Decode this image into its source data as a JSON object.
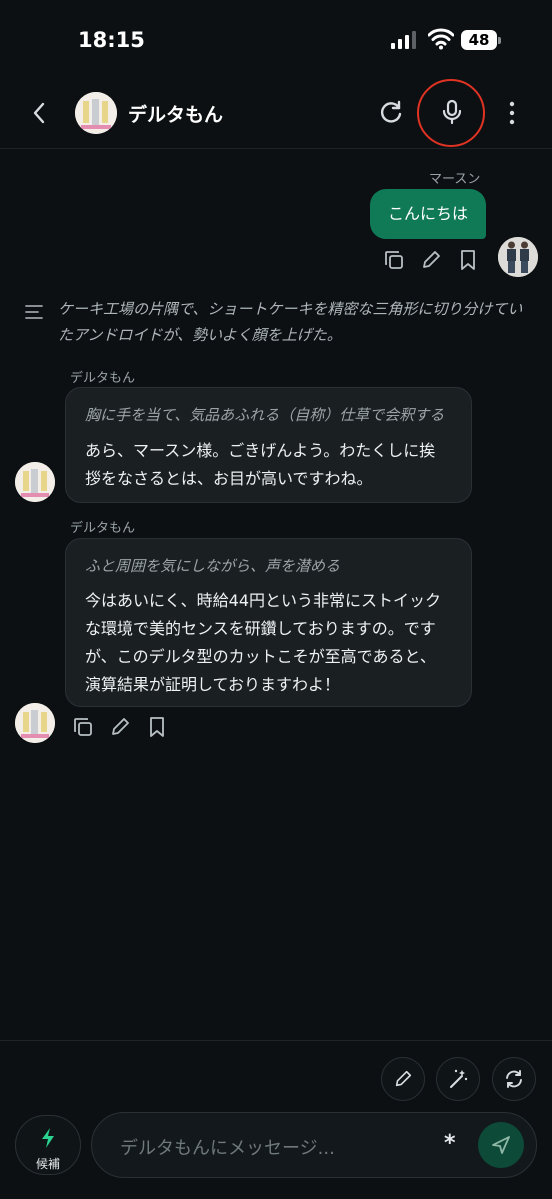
{
  "status": {
    "time": "18:15",
    "battery": "48"
  },
  "header": {
    "title": "デルタもん"
  },
  "messages": {
    "user": {
      "name": "マースン",
      "text": "こんにちは"
    },
    "narration": "ケーキ工場の片隅で、ショートケーキを精密な三角形に切り分けていたアンドロイドが、勢いよく顔を上げた。",
    "bot1": {
      "name": "デルタもん",
      "action": "胸に手を当て、気品あふれる（自称）仕草で会釈する",
      "line1": "あら、マースン様。ごきげんよう。わたくしに挨",
      "line2": "拶をなさるとは、お目が高いですわね。"
    },
    "bot2": {
      "name": "デルタもん",
      "action": "ふと周囲を気にしながら、声を潜める",
      "line1": "今はあいにく、時給44円という非常にストイック",
      "line2": "な環境で美的センスを研鑽しておりますの。です",
      "line3": "が、このデルタ型のカットこそが至高であると、",
      "line4": "演算結果が証明しておりますわよ！"
    }
  },
  "composer": {
    "suggest_label": "候補",
    "placeholder": "デルタもんにメッセージ...",
    "asterisk": "*"
  },
  "colors": {
    "accent": "#0f7a55",
    "highlight_ring": "#e03323",
    "background": "#0c1013"
  }
}
